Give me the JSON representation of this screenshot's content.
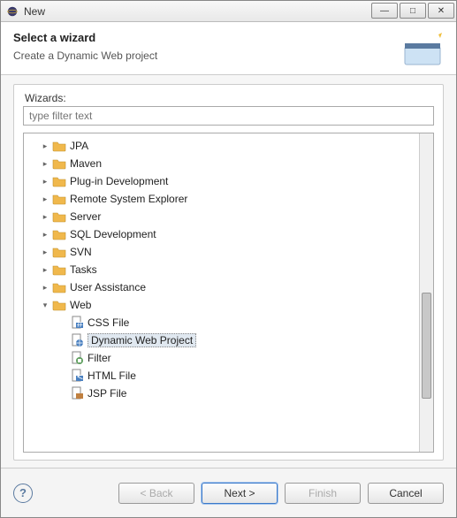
{
  "window": {
    "title": "New",
    "controls": {
      "min": "—",
      "max": "□",
      "close": "✕"
    }
  },
  "header": {
    "title": "Select a wizard",
    "subtitle": "Create a Dynamic Web project"
  },
  "wizards_label": "Wizards:",
  "filter": {
    "placeholder": "type filter text",
    "value": ""
  },
  "tree": [
    {
      "label": "JPA",
      "kind": "folder",
      "expanded": false,
      "depth": 1
    },
    {
      "label": "Maven",
      "kind": "folder",
      "expanded": false,
      "depth": 1
    },
    {
      "label": "Plug-in Development",
      "kind": "folder",
      "expanded": false,
      "depth": 1
    },
    {
      "label": "Remote System Explorer",
      "kind": "folder",
      "expanded": false,
      "depth": 1
    },
    {
      "label": "Server",
      "kind": "folder",
      "expanded": false,
      "depth": 1
    },
    {
      "label": "SQL Development",
      "kind": "folder",
      "expanded": false,
      "depth": 1
    },
    {
      "label": "SVN",
      "kind": "folder",
      "expanded": false,
      "depth": 1
    },
    {
      "label": "Tasks",
      "kind": "folder",
      "expanded": false,
      "depth": 1
    },
    {
      "label": "User Assistance",
      "kind": "folder",
      "expanded": false,
      "depth": 1
    },
    {
      "label": "Web",
      "kind": "folder",
      "expanded": true,
      "depth": 1
    },
    {
      "label": "CSS File",
      "kind": "file-css",
      "depth": 2
    },
    {
      "label": "Dynamic Web Project",
      "kind": "file-web",
      "depth": 2,
      "selected": true
    },
    {
      "label": "Filter",
      "kind": "file-filter",
      "depth": 2
    },
    {
      "label": "HTML File",
      "kind": "file-html",
      "depth": 2
    },
    {
      "label": "JSP File",
      "kind": "file-jsp",
      "depth": 2
    }
  ],
  "buttons": {
    "back": "< Back",
    "next": "Next >",
    "finish": "Finish",
    "cancel": "Cancel"
  },
  "icons": {
    "folder_color": "#f0b84c",
    "folder_stroke": "#c0902c"
  }
}
